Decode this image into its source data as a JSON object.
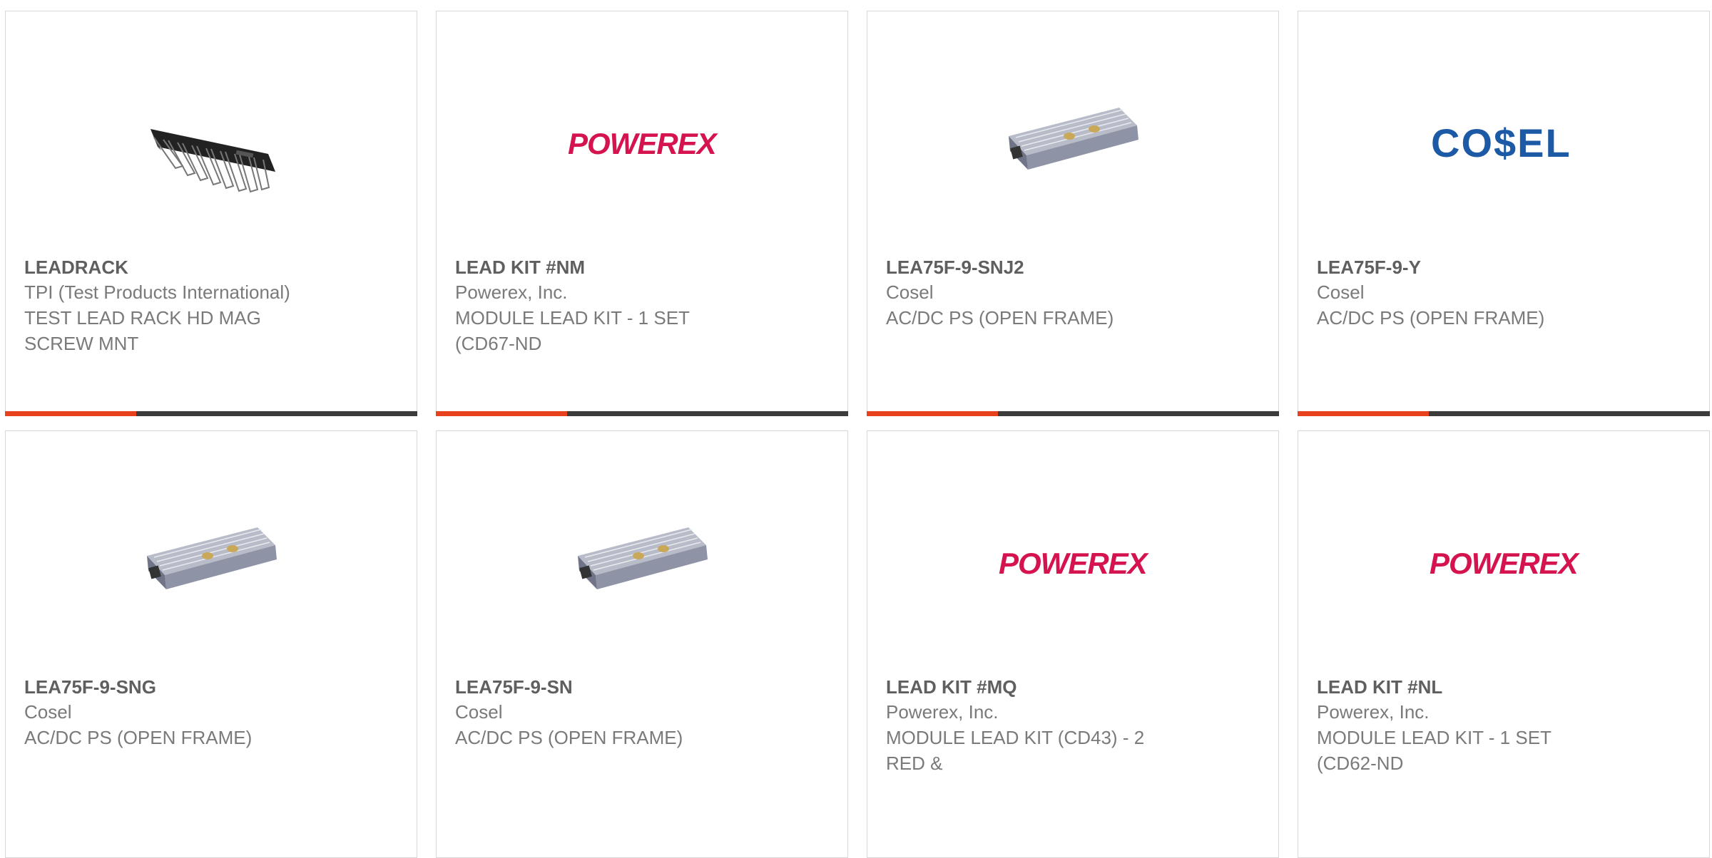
{
  "products": [
    {
      "part": "LEADRACK",
      "manufacturer": "TPI (Test Products International)",
      "desc_line1": "TEST LEAD RACK HD MAG",
      "desc_line2": "SCREW MNT",
      "image": "lead-rack-image"
    },
    {
      "part": "LEAD KIT #NM",
      "manufacturer": "Powerex, Inc.",
      "desc_line1": "MODULE LEAD KIT - 1 SET",
      "desc_line2": "(CD67-ND",
      "image": "powerex-logo",
      "logo_text": "POWEREX"
    },
    {
      "part": "LEA75F-9-SNJ2",
      "manufacturer": "Cosel",
      "desc_line1": "AC/DC PS (OPEN FRAME)",
      "desc_line2": "",
      "image": "power-supply-image"
    },
    {
      "part": "LEA75F-9-Y",
      "manufacturer": "Cosel",
      "desc_line1": "AC/DC PS (OPEN FRAME)",
      "desc_line2": "",
      "image": "cosel-logo",
      "logo_text": "CO$EL"
    },
    {
      "part": "LEA75F-9-SNG",
      "manufacturer": "Cosel",
      "desc_line1": "AC/DC PS (OPEN FRAME)",
      "desc_line2": "",
      "image": "power-supply-image"
    },
    {
      "part": "LEA75F-9-SN",
      "manufacturer": "Cosel",
      "desc_line1": "AC/DC PS (OPEN FRAME)",
      "desc_line2": "",
      "image": "power-supply-image"
    },
    {
      "part": "LEAD KIT #MQ",
      "manufacturer": "Powerex, Inc.",
      "desc_line1": "MODULE LEAD KIT (CD43) - 2",
      "desc_line2": "RED &",
      "image": "powerex-logo",
      "logo_text": "POWEREX"
    },
    {
      "part": "LEAD KIT #NL",
      "manufacturer": "Powerex, Inc.",
      "desc_line1": "MODULE LEAD KIT - 1 SET",
      "desc_line2": "(CD62-ND",
      "image": "powerex-logo",
      "logo_text": "POWEREX"
    }
  ],
  "colors": {
    "accent": "#e8411d",
    "bar": "#3c3c3c",
    "powerex": "#d4134f",
    "cosel": "#1d5aa6"
  }
}
